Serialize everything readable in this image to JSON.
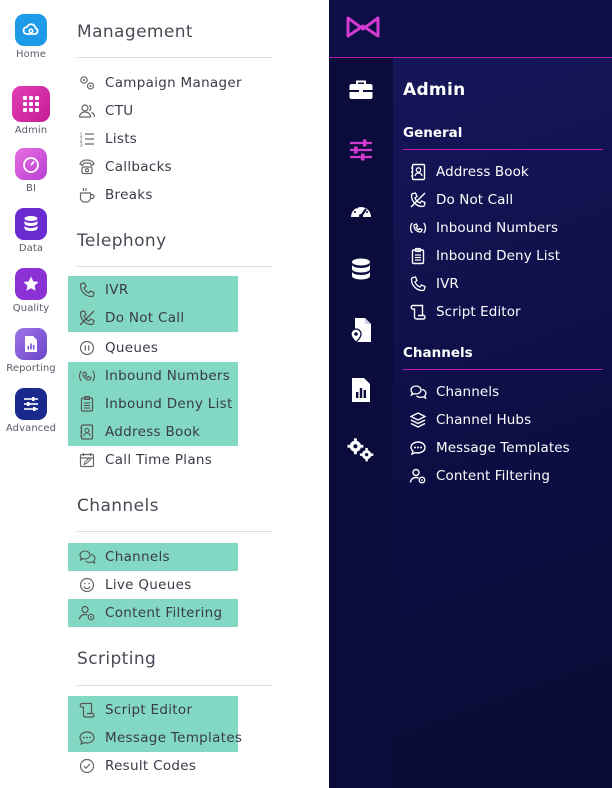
{
  "colors": {
    "accent": "#d23ad0",
    "highlight": "#82d8c3",
    "dark_bg": "#0c0d42"
  },
  "rail": {
    "items": [
      {
        "label": "Home",
        "icon": "cloud-icon"
      },
      {
        "label": "Admin",
        "icon": "grid-icon"
      },
      {
        "label": "BI",
        "icon": "gauge-icon"
      },
      {
        "label": "Data",
        "icon": "database-icon"
      },
      {
        "label": "Quality",
        "icon": "star-icon"
      },
      {
        "label": "Reporting",
        "icon": "report-icon"
      },
      {
        "label": "Advanced",
        "icon": "sliders-icon"
      }
    ]
  },
  "menu": {
    "management": {
      "title": "Management",
      "items": [
        {
          "label": "Campaign Manager",
          "icon": "gears-icon"
        },
        {
          "label": "CTU",
          "icon": "users-icon"
        },
        {
          "label": "Lists",
          "icon": "numbered-list-icon"
        },
        {
          "label": "Callbacks",
          "icon": "phone-icon"
        },
        {
          "label": "Breaks",
          "icon": "coffee-icon"
        }
      ]
    },
    "telephony": {
      "title": "Telephony",
      "items": [
        {
          "label": "IVR",
          "icon": "phone-icon"
        },
        {
          "label": "Do Not Call",
          "icon": "phone-slash-icon"
        },
        {
          "label": "Queues",
          "icon": "pause-circle-icon"
        },
        {
          "label": "Inbound Numbers",
          "icon": "phone-volume-icon"
        },
        {
          "label": "Inbound Deny List",
          "icon": "clipboard-list-icon"
        },
        {
          "label": "Address Book",
          "icon": "address-book-icon"
        },
        {
          "label": "Call Time Plans",
          "icon": "calendar-edit-icon"
        }
      ]
    },
    "channels": {
      "title": "Channels",
      "items": [
        {
          "label": "Channels",
          "icon": "comments-icon"
        },
        {
          "label": "Live Queues",
          "icon": "smile-icon"
        },
        {
          "label": "Content Filtering",
          "icon": "user-cog-icon"
        }
      ]
    },
    "scripting": {
      "title": "Scripting",
      "items": [
        {
          "label": "Script Editor",
          "icon": "scroll-icon"
        },
        {
          "label": "Message Templates",
          "icon": "comment-dots-icon"
        },
        {
          "label": "Result Codes",
          "icon": "check-circle-icon"
        }
      ]
    }
  },
  "admin": {
    "title": "Admin",
    "general": {
      "title": "General",
      "items": [
        {
          "label": "Address Book",
          "icon": "address-book-icon"
        },
        {
          "label": "Do Not Call",
          "icon": "phone-slash-icon"
        },
        {
          "label": "Inbound Numbers",
          "icon": "phone-volume-icon"
        },
        {
          "label": "Inbound Deny List",
          "icon": "clipboard-list-icon"
        },
        {
          "label": "IVR",
          "icon": "phone-icon"
        },
        {
          "label": "Script Editor",
          "icon": "scroll-icon"
        }
      ]
    },
    "channels": {
      "title": "Channels",
      "items": [
        {
          "label": "Channels",
          "icon": "comments-icon"
        },
        {
          "label": "Channel Hubs",
          "icon": "layers-icon"
        },
        {
          "label": "Message Templates",
          "icon": "comment-dots-icon"
        },
        {
          "label": "Content Filtering",
          "icon": "user-cog-icon"
        }
      ]
    }
  }
}
